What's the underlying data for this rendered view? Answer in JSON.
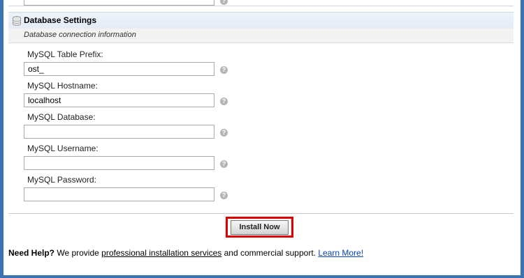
{
  "section": {
    "title": "Database Settings",
    "subtitle": "Database connection information",
    "icon": "database-icon"
  },
  "fields": [
    {
      "label": "MySQL Table Prefix:",
      "value": "ost_"
    },
    {
      "label": "MySQL Hostname:",
      "value": "localhost"
    },
    {
      "label": "MySQL Database:",
      "value": ""
    },
    {
      "label": "MySQL Username:",
      "value": ""
    },
    {
      "label": "MySQL Password:",
      "value": ""
    }
  ],
  "help_glyph": "?",
  "install_button": {
    "label": "Install Now"
  },
  "footer": {
    "need_help": "Need Help?",
    "text1": " We provide ",
    "link_services": "professional installation services",
    "text2": " and commercial support. ",
    "link_more": "Learn More!"
  },
  "colors": {
    "frame": "#3a74b3",
    "highlight": "#e00000",
    "link": "#0645ad"
  }
}
